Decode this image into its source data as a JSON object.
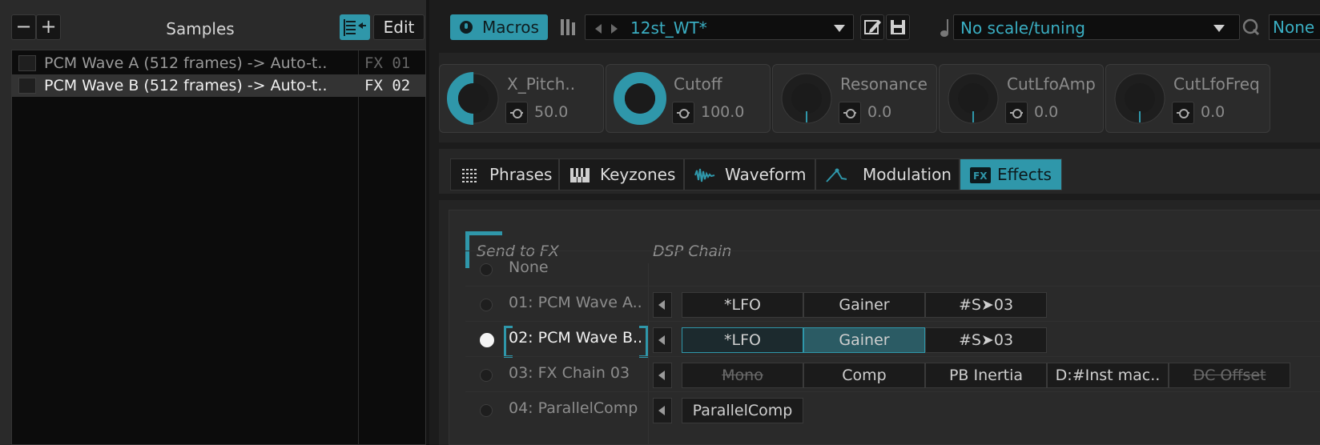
{
  "samples": {
    "title": "Samples",
    "minus_label": "−",
    "plus_label": "+",
    "edit_label": "Edit",
    "items": [
      {
        "name": "PCM Wave A (512 frames) -> Auto-t..",
        "fx": "FX 01",
        "selected": false
      },
      {
        "name": "PCM Wave B (512 frames) -> Auto-t..",
        "fx": "FX 02",
        "selected": true
      }
    ]
  },
  "toolbar": {
    "macros_label": "Macros",
    "preset_name": "12st_WT*",
    "scale_name": "No scale/tuning",
    "quantize_value": "None",
    "accent_color": "#2f97aa"
  },
  "macros": [
    {
      "name": "X_Pitch..",
      "value": "50.0",
      "level": 0.5
    },
    {
      "name": "Cutoff",
      "value": "100.0",
      "level": 1.0
    },
    {
      "name": "Resonance",
      "value": "0.0",
      "level": 0.0
    },
    {
      "name": "CutLfoAmp",
      "value": "0.0",
      "level": 0.0
    },
    {
      "name": "CutLfoFreq",
      "value": "0.0",
      "level": 0.0
    }
  ],
  "tabs": [
    {
      "label": "Phrases",
      "icon": "phrases-grid-icon",
      "active": false
    },
    {
      "label": "Keyzones",
      "icon": "keyboard-icon",
      "active": false
    },
    {
      "label": "Waveform",
      "icon": "waveform-icon",
      "active": false
    },
    {
      "label": "Modulation",
      "icon": "modulation-curve-icon",
      "active": false
    },
    {
      "label": "Effects",
      "icon": "fx-icon",
      "active": true
    }
  ],
  "effects": {
    "header_send": "Send to FX",
    "header_dsp": "DSP Chain",
    "chains": [
      {
        "name": "None",
        "selected": false,
        "devices": []
      },
      {
        "name": "01: PCM Wave A..",
        "selected": false,
        "devices": [
          "*LFO",
          "Gainer",
          "#S➤03"
        ]
      },
      {
        "name": "02: PCM Wave B..",
        "selected": true,
        "devices": [
          "*LFO",
          "Gainer",
          "#S➤03"
        ]
      },
      {
        "name": "03: FX Chain 03",
        "selected": false,
        "devices": [
          "Mono",
          "Comp",
          "PB Inertia",
          "D:#Inst mac..",
          "DC Offset"
        ]
      },
      {
        "name": "04: ParallelComp",
        "selected": false,
        "devices": [
          "ParallelComp"
        ]
      }
    ]
  }
}
